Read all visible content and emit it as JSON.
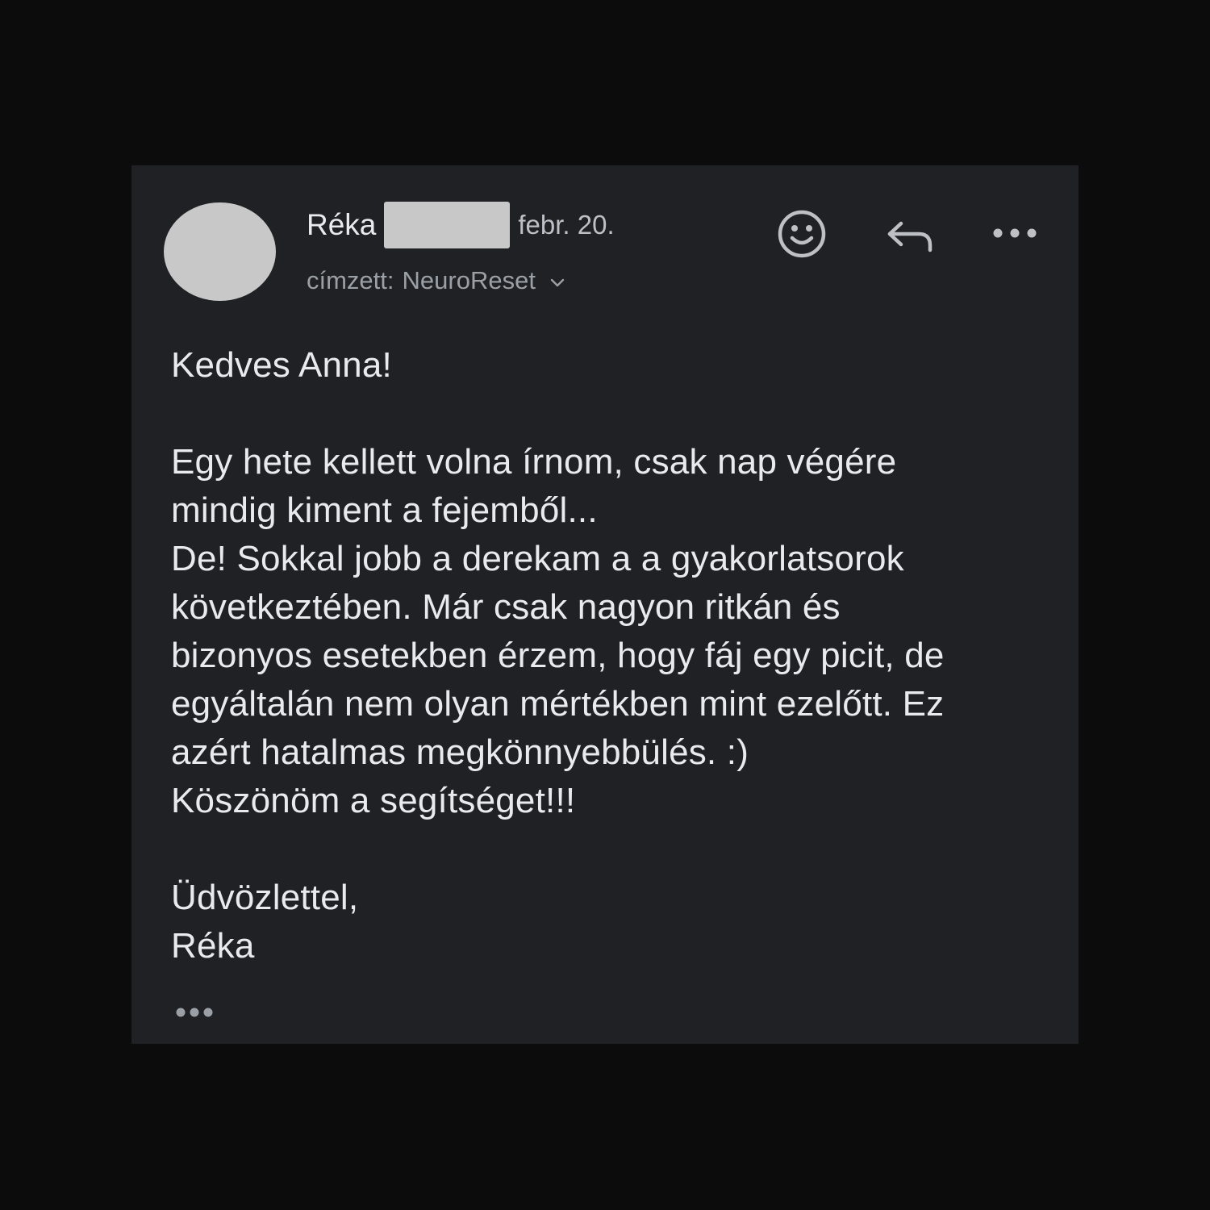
{
  "message": {
    "sender_name": "Réka",
    "date": "febr. 20.",
    "recipient_label": "címzett:",
    "recipient_name": "NeuroReset",
    "actions": {
      "emoji_icon": "smiley-icon",
      "reply_icon": "reply-icon",
      "more_icon": "more-horizontal-icon"
    },
    "body": {
      "greeting": "Kedves Anna!",
      "lines": [
        "Egy hete kellett volna írnom, csak nap végére",
        "mindig kiment a fejemből...",
        "De! Sokkal jobb a derekam a a gyakorlatsorok",
        "következtében. Már csak nagyon ritkán és",
        "bizonyos esetekben érzem, hogy fáj egy picit, de",
        "egyáltalán nem olyan mértékben mint ezelőtt. Ez",
        "azért hatalmas megkönnyebbülés. :)",
        "Köszönöm a segítséget!!!"
      ],
      "closing": "Üdvözlettel,",
      "signature": "Réka"
    },
    "trimmed_content_icon": "ellipsis-icon"
  },
  "colors": {
    "page_background": "#0c0c0d",
    "card_background": "#202124",
    "primary_text": "#e8eaed",
    "secondary_text": "#9aa0a6",
    "icon_color": "#bdc1c6",
    "redaction": "#c8c8c8"
  }
}
